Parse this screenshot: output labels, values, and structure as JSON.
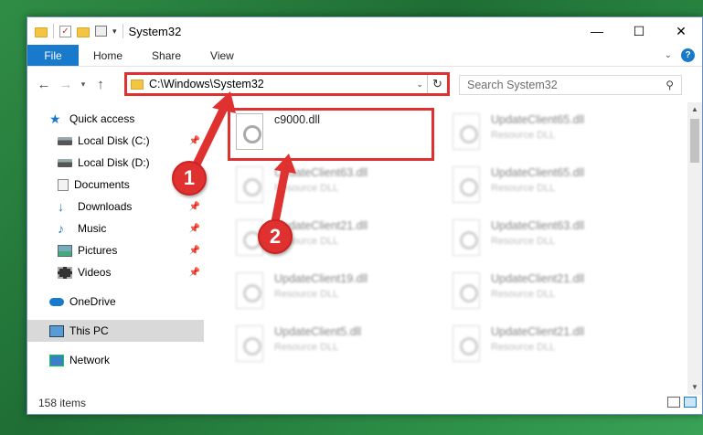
{
  "window": {
    "title": "System32",
    "controls": [
      "minimize",
      "maximize",
      "close"
    ]
  },
  "ribbon": {
    "tabs": [
      "File",
      "Home",
      "Share",
      "View"
    ],
    "help": "?"
  },
  "address": {
    "path": "C:\\Windows\\System32",
    "search_placeholder": "Search System32"
  },
  "sidebar": {
    "items": [
      {
        "label": "Quick access",
        "icon": "star-icon"
      },
      {
        "label": "Local Disk (C:)",
        "icon": "drive-icon",
        "pinned": true
      },
      {
        "label": "Local Disk (D:)",
        "icon": "drive-icon",
        "pinned": false
      },
      {
        "label": "Documents",
        "icon": "documents-icon",
        "pinned": true
      },
      {
        "label": "Downloads",
        "icon": "download-icon",
        "pinned": true
      },
      {
        "label": "Music",
        "icon": "music-icon",
        "pinned": true
      },
      {
        "label": "Pictures",
        "icon": "pictures-icon",
        "pinned": true
      },
      {
        "label": "Videos",
        "icon": "videos-icon",
        "pinned": true
      },
      {
        "label": "OneDrive",
        "icon": "onedrive-icon"
      },
      {
        "label": "This PC",
        "icon": "pc-icon",
        "selected": true
      },
      {
        "label": "Network",
        "icon": "network-icon"
      }
    ]
  },
  "files": [
    {
      "name": "c9000.dll",
      "type": ""
    },
    {
      "name": "UpdateClient65.dll",
      "type": "Resource DLL"
    },
    {
      "name": "UpdateClient63.dll",
      "type": "Resource DLL"
    },
    {
      "name": "UpdateClient65.dll",
      "type": "Resource DLL"
    },
    {
      "name": "UpdateClient21.dll",
      "type": "Resource DLL"
    },
    {
      "name": "UpdateClient63.dll",
      "type": "Resource DLL"
    },
    {
      "name": "UpdateClient19.dll",
      "type": "Resource DLL"
    },
    {
      "name": "UpdateClient21.dll",
      "type": "Resource DLL"
    },
    {
      "name": "UpdateClient5.dll",
      "type": "Resource DLL"
    },
    {
      "name": "UpdateClient21.dll",
      "type": "Resource DLL"
    }
  ],
  "status": {
    "item_count": "158 items"
  },
  "annotations": {
    "step1": "1",
    "step2": "2",
    "color": "#e03131"
  }
}
